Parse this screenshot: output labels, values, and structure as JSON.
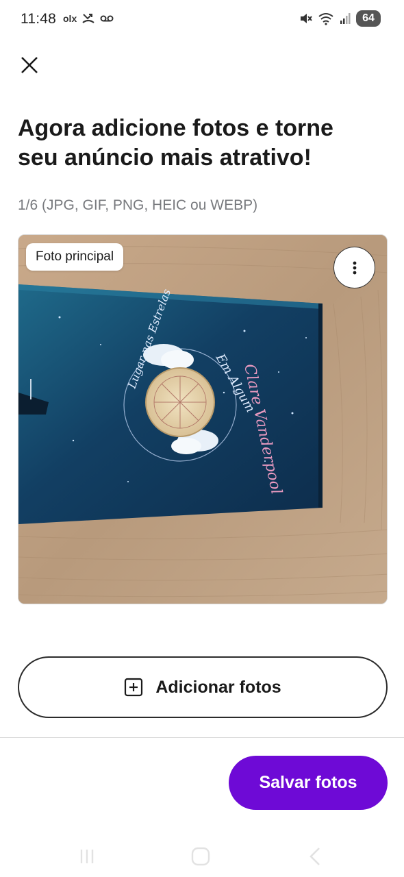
{
  "status_bar": {
    "time": "11:48",
    "notifications": [
      "olx",
      "missed-call-icon",
      "voicemail-icon"
    ],
    "olx_label": "olx",
    "battery": "64"
  },
  "header": {
    "close_icon": "close-icon"
  },
  "title": "Agora adicione fotos e torne seu anúncio mais atrativo!",
  "subtitle": "1/6 (JPG, GIF, PNG, HEIC ou WEBP)",
  "photo": {
    "badge": "Foto principal",
    "menu_icon": "more-vertical-icon",
    "book_title": "Clare Vanderpool",
    "book_text_1": "Em Algum",
    "book_text_2": "Lugar nas Estrelas"
  },
  "add_button": {
    "label": "Adicionar fotos",
    "icon": "plus-square-icon"
  },
  "save_button": {
    "label": "Salvar fotos",
    "color": "#6e0ad6"
  },
  "nav": {
    "recents_icon": "recents-icon",
    "home_icon": "home-icon",
    "back_icon": "back-icon"
  }
}
